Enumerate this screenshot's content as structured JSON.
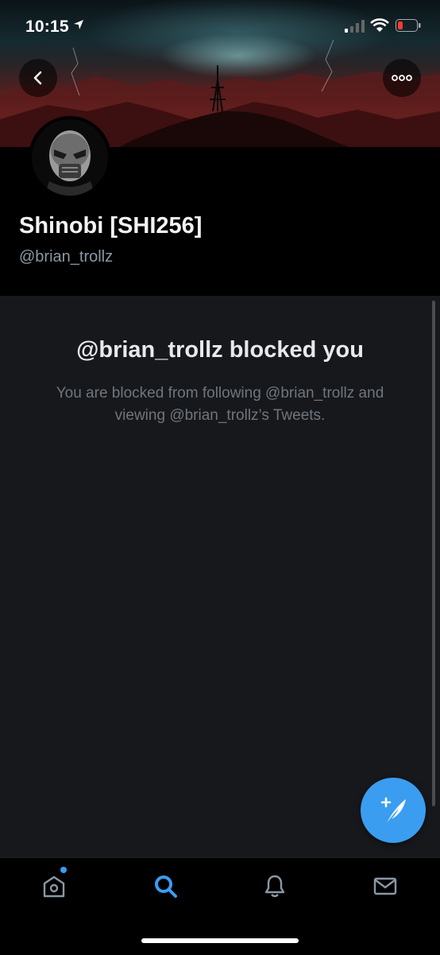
{
  "status_bar": {
    "time": "10:15"
  },
  "header": {
    "back_icon": "chevron-left-icon",
    "more_icon": "more-horizontal-icon"
  },
  "profile": {
    "display_name": "Shinobi [SHI256]",
    "handle": "@brian_trollz"
  },
  "blocked_notice": {
    "title": "@brian_trollz blocked you",
    "message": "You are blocked from following @brian_trollz and viewing @brian_trollz’s Tweets."
  },
  "fab": {
    "icon": "compose-tweet-icon"
  },
  "tab_bar": {
    "items": [
      {
        "icon": "home-icon",
        "active": false,
        "has_badge": true
      },
      {
        "icon": "search-icon",
        "active": true,
        "has_badge": false
      },
      {
        "icon": "bell-icon",
        "active": false,
        "has_badge": false
      },
      {
        "icon": "mail-icon",
        "active": false,
        "has_badge": false
      }
    ]
  },
  "colors": {
    "accent": "#3a9df0",
    "content_bg": "#17181c",
    "muted_text": "#6e767d",
    "handle_text": "#8b98a5"
  }
}
